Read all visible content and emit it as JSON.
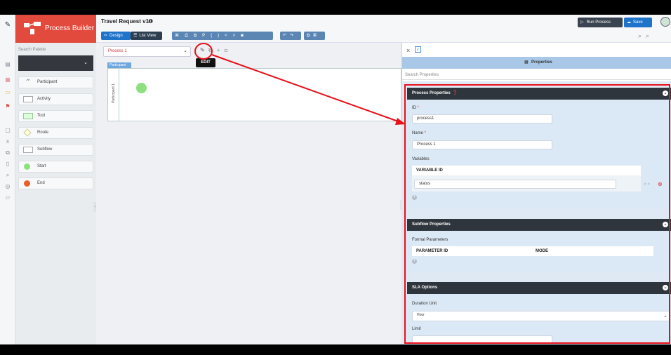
{
  "brand": {
    "title": "Process Builder"
  },
  "header": {
    "title": "Travel Request v1",
    "design_tab": "Design",
    "list_view_tab": "List View",
    "run_process": "Run Process",
    "save": "Save"
  },
  "palette": {
    "search_placeholder": "Search Palette",
    "items": [
      {
        "label": "Participant"
      },
      {
        "label": "Activity"
      },
      {
        "label": "Tool"
      },
      {
        "label": "Route"
      },
      {
        "label": "Subflow"
      },
      {
        "label": "Start"
      },
      {
        "label": "End"
      }
    ]
  },
  "canvas": {
    "process_select": "Process 1",
    "tooltip": "EDIT",
    "participant_tab": "Participant",
    "lane_label": "Participant 1"
  },
  "properties": {
    "title": "Properties",
    "search_placeholder": "Search Properties",
    "process_section": "Process Properties",
    "id_label": "ID",
    "id_value": "process1",
    "name_label": "Name",
    "name_value": "Process 1",
    "variables_label": "Variables",
    "variable_id_header": "VARIABLE ID",
    "variable_value": "status",
    "subflow_section": "Subflow Properties",
    "formal_params_label": "Formal Parameters",
    "param_id_header": "PARAMETER ID",
    "mode_header": "MODE",
    "sla_section": "SLA Options",
    "duration_unit_label": "Duration Unit",
    "duration_unit_value": "Hour",
    "limit_label": "Limit"
  },
  "colors": {
    "brand": "#e14a3c",
    "accent": "#1f73c9",
    "annotation": "#e8101a",
    "start": "#8ee07f",
    "end": "#e8602c"
  }
}
